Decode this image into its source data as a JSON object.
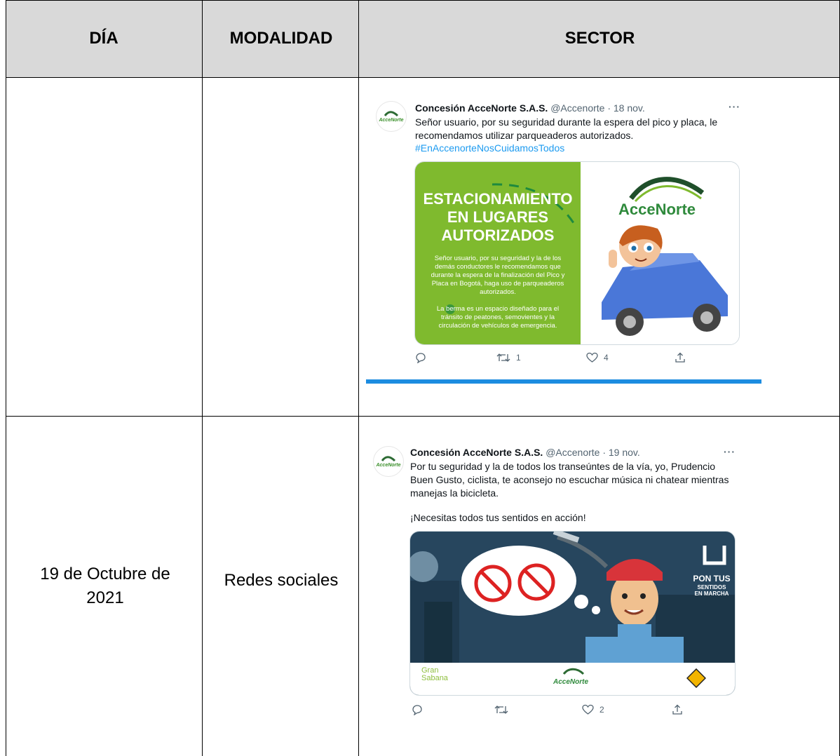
{
  "table": {
    "headers": [
      "DÍA",
      "MODALIDAD",
      "SECTOR"
    ],
    "rows": [
      {
        "dia": "",
        "modalidad": ""
      },
      {
        "dia": "19 de Octubre de 2021",
        "modalidad": "Redes sociales"
      }
    ]
  },
  "tweets": [
    {
      "avatar_text": "AcceNorte",
      "name": "Concesión AcceNorte S.A.S.",
      "meta": "@Accenorte · 18 nov.",
      "more": "···",
      "text": "Señor usuario, por su seguridad durante la espera del pico y placa, le recomendamos utilizar parqueaderos autorizados.",
      "hashtag": "#EnAccenorteNosCuidamosTodos",
      "media": {
        "title": "ESTACIONAMIENTO EN LUGARES AUTORIZADOS",
        "body": "Señor usuario, por su seguridad y la de los demás conductores le recomendamos que durante la espera de la finalización del Pico y Placa en Bogotá, haga uso de parqueaderos autorizados.",
        "body2": "La berma es un espacio diseñado para el tránsito de peatones, semovientes y la circulación de vehículos de emergencia.",
        "brand": "AcceNorte",
        "left_color": "#7fba2e"
      },
      "actions": {
        "reply": "",
        "retweet": "1",
        "like": "4",
        "share": ""
      }
    },
    {
      "avatar_text": "AcceNorte",
      "name": "Concesión AcceNorte S.A.S.",
      "meta": "@Accenorte · 19 nov.",
      "more": "···",
      "text": "Por tu seguridad y la de todos los transeúntes de la vía, yo, Prudencio Buen Gusto, ciclista, te aconsejo no escuchar música ni chatear mientras manejas la bicicleta.",
      "text2": "¡Necesitas todos tus sentidos en acción!",
      "media": {
        "sign_big": "PON TUS",
        "sign_small": "SENTIDOS",
        "sign_bottom": "EN MARCHA",
        "logo_left": "Gran Sabana",
        "logo_center": "AcceNorte",
        "bg_color": "#27465e"
      },
      "actions": {
        "reply": "",
        "retweet": "",
        "like": "2",
        "share": ""
      }
    }
  ],
  "colors": {
    "header_bg": "#d9d9d9",
    "link": "#1d9bf0",
    "brand_green": "#2f8a3c"
  }
}
